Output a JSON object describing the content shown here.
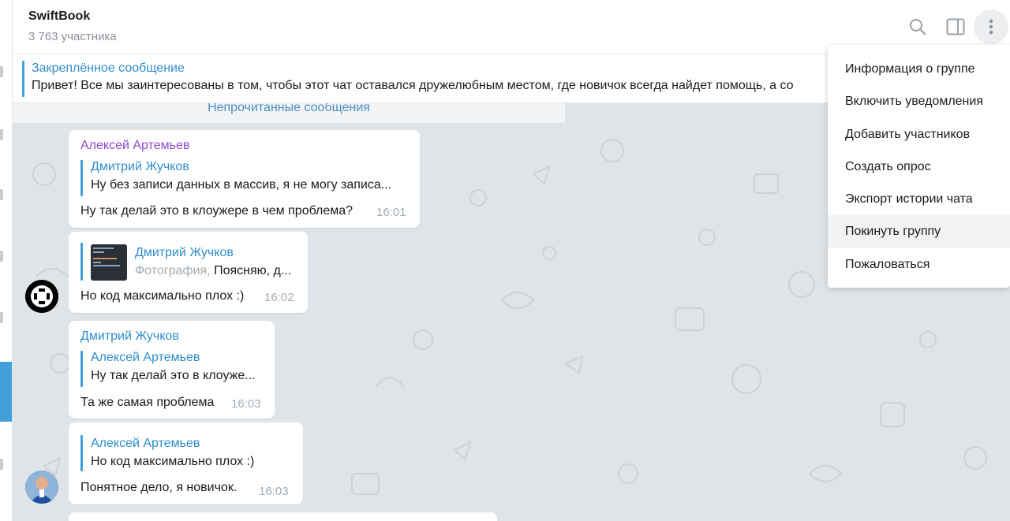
{
  "header": {
    "title": "SwiftBook",
    "subtitle": "3 763 участника",
    "icons": [
      "search-icon",
      "sidebar-toggle-icon",
      "more-vertical-icon"
    ]
  },
  "pinned": {
    "title": "Закреплённое сообщение",
    "text": "Привет! Все мы заинтересованы в том, чтобы этот чат оставался дружелюбным местом, где новичок всегда найдет помощь, а со"
  },
  "unread_label": "Непрочитанные сообщения",
  "messages": [
    {
      "sender": "Алексей Артемьев",
      "sender_color": "#8e4bd1",
      "reply_name": "Дмитрий Жучков",
      "reply_text": "Ну без записи данных в массив, я не могу записа...",
      "text": "Ну так делай это в клоужере в чем проблема?",
      "time": "16:01"
    },
    {
      "reply_name": "Дмитрий Жучков",
      "reply_prefix": "Фотография,",
      "reply_text": "Поясняю, д...",
      "text": "Но код максимально плох :)",
      "time": "16:02"
    },
    {
      "sender": "Дмитрий Жучков",
      "sender_color": "#2f8ccc",
      "reply_name": "Алексей Артемьев",
      "reply_text": "Ну так делай это в клоуже...",
      "text": "Та же самая проблема",
      "time": "16:03"
    },
    {
      "reply_name": "Алексей Артемьев",
      "reply_text": "Но код максимально плох :)",
      "text": "Понятное дело, я новичок.",
      "time": "16:03"
    }
  ],
  "menu": {
    "items": [
      "Информация о группе",
      "Включить уведомления",
      "Добавить участников",
      "Создать опрос",
      "Экспорт истории чата",
      "Покинуть группу",
      "Пожаловаться"
    ]
  },
  "colors": {
    "accent": "#419fd9",
    "link": "#2f8ccc",
    "chat_bg": "#dfe4e8",
    "time": "#a3acb4"
  }
}
